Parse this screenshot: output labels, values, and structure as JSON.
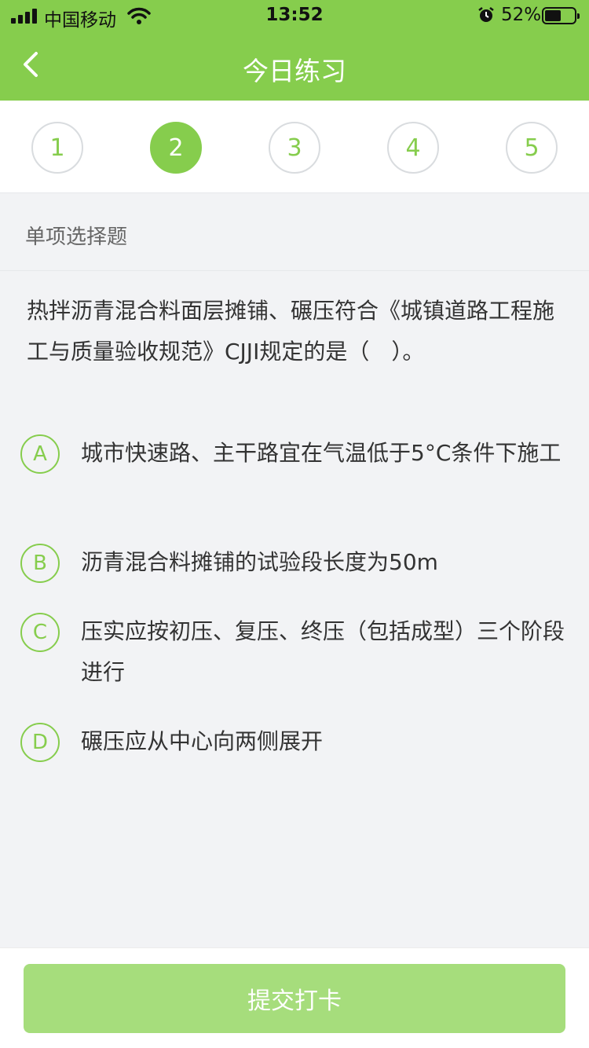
{
  "status_bar": {
    "carrier": "中国移动",
    "time": "13:52",
    "battery_percent": "52%"
  },
  "nav": {
    "back_icon": "chevron-left-icon",
    "title": "今日练习"
  },
  "steps": [
    {
      "label": "1",
      "active": false
    },
    {
      "label": "2",
      "active": true
    },
    {
      "label": "3",
      "active": false
    },
    {
      "label": "4",
      "active": false
    },
    {
      "label": "5",
      "active": false
    }
  ],
  "question": {
    "type": "单项选择题",
    "text": "热拌沥青混合料面层摊铺、碾压符合《城镇道路工程施工与质量验收规范》CJJI规定的是（　）。",
    "options": [
      {
        "letter": "A",
        "text": "城市快速路、主干路宜在气温低于5°C条件下施工"
      },
      {
        "letter": "B",
        "text": "沥青混合料摊铺的试验段长度为50m"
      },
      {
        "letter": "C",
        "text": "压实应按初压、复压、终压（包括成型）三个阶段进行"
      },
      {
        "letter": "D",
        "text": "碾压应从中心向两侧展开"
      }
    ]
  },
  "footer": {
    "submit_label": "提交打卡"
  },
  "colors": {
    "accent": "#86cd4d",
    "button_disabled": "#a6dd7c",
    "page_bg": "#f2f3f5"
  }
}
